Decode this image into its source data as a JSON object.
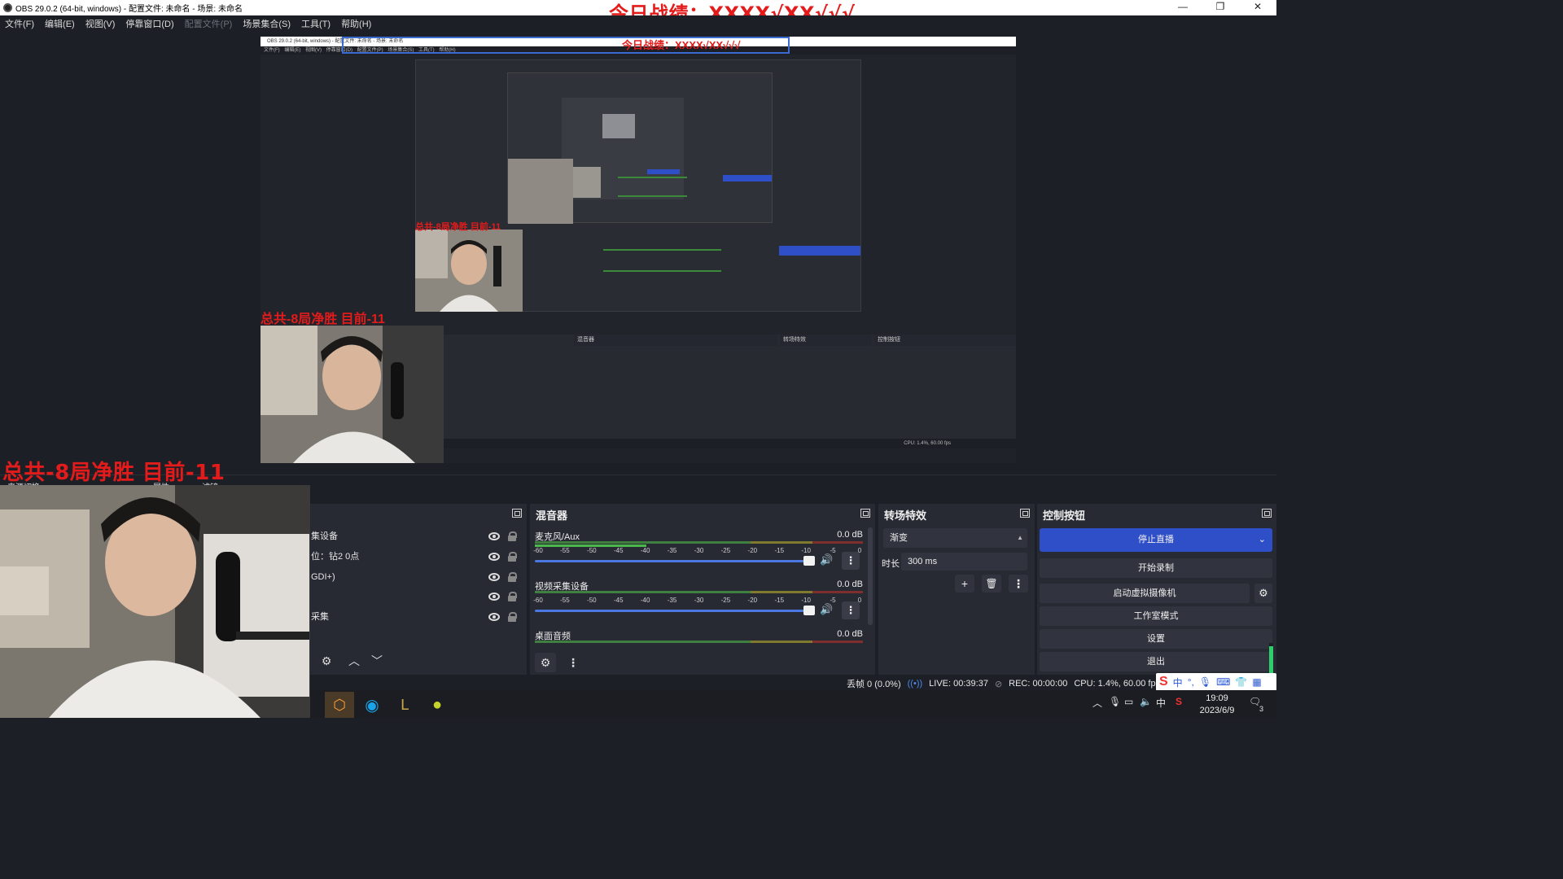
{
  "window": {
    "title": "OBS 29.0.2 (64-bit, windows) - 配置文件: 未命名 - 场景: 未命名",
    "overlay_title": "今日战绩：XXXX√XX√√√",
    "controls": [
      "—",
      "❐",
      "✕"
    ]
  },
  "menu": [
    "文件(F)",
    "编辑(E)",
    "视图(V)",
    "停靠窗口(D)",
    "配置文件(P)",
    "场景集合(S)",
    "工具(T)",
    "帮助(H)"
  ],
  "preview": {
    "nested_title": "OBS 29.0.2 (64-bit, windows) - 配置文件: 未命名 - 场景: 未命名",
    "nested_menu": "文件(F) 编辑(E) 视图(V) 停靠窗口(D) 配置文件(P) 场景集合(S) 工具(T) 帮助(H)",
    "nested_overlay": "今日战绩：XXXX√XX√√√",
    "nested_score": "总共-8局净胜 目前-11"
  },
  "overlay_score": "总共-8局净胜   目前-11",
  "dock_tabs": {
    "scene_tab": "来源切换",
    "props_tab": "属性",
    "filters_tab": "滤镜"
  },
  "sources": {
    "items": [
      {
        "label": "集设备"
      },
      {
        "label": "位：钻2 0点"
      },
      {
        "label": "GDI+)"
      },
      {
        "label": ""
      },
      {
        "label": "采集"
      }
    ]
  },
  "mixer": {
    "title": "混音器",
    "channels": [
      {
        "name": "麦克风/Aux",
        "db": "0.0 dB",
        "level": 0.34
      },
      {
        "name": "视频采集设备",
        "db": "0.0 dB",
        "level": 0.0
      },
      {
        "name": "桌面音频",
        "db": "0.0 dB",
        "level": 0.0
      }
    ],
    "ticks": [
      "-60",
      "-55",
      "-50",
      "-45",
      "-40",
      "-35",
      "-30",
      "-25",
      "-20",
      "-15",
      "-10",
      "-5",
      "0"
    ]
  },
  "transitions": {
    "title": "转场特效",
    "selected": "渐变",
    "duration_label": "时长",
    "duration_value": "300 ms"
  },
  "controls": {
    "title": "控制按钮",
    "stop_stream": "停止直播",
    "start_record": "开始录制",
    "virtual_cam": "启动虚拟摄像机",
    "studio_mode": "工作室模式",
    "settings": "设置",
    "exit": "退出"
  },
  "status": {
    "dropped": "丢帧 0 (0.0%)",
    "live": "LIVE: 00:39:37",
    "rec": "REC: 00:00:00",
    "cpu": "CPU: 1.4%, 60.00 fps"
  },
  "taskbar": {
    "time": "19:09",
    "date": "2023/6/9",
    "ime_lang": "中",
    "notif_count": "3"
  },
  "colors": {
    "accent": "#2f4fc9",
    "overlay_red": "#e31b1b",
    "background": "#1d1f26",
    "dock": "#272a33"
  }
}
